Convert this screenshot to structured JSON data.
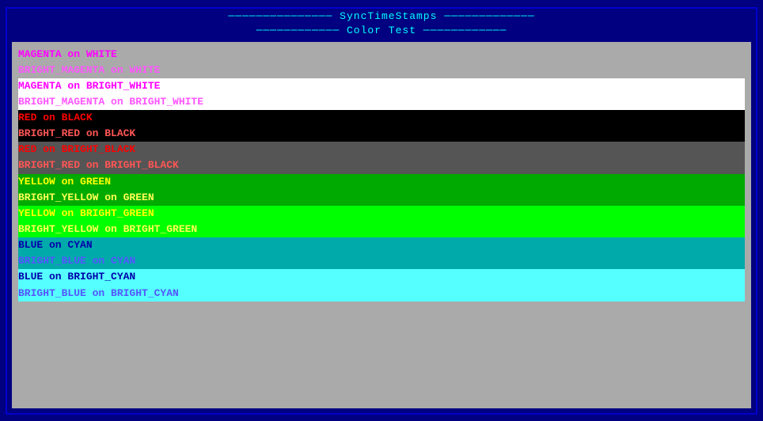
{
  "window": {
    "title": "─────────────── SyncTimeStamps ─────────────",
    "subtitle": "──────────── Color Test ────────────"
  },
  "lines": [
    {
      "id": "magenta-on-white",
      "text": "MAGENTA on WHITE",
      "fg": "#ff00ff",
      "bg": "#aaaaaa"
    },
    {
      "id": "bright-magenta-on-white",
      "text": "BRIGHT_MAGENTA on WHITE",
      "fg": "#ff55ff",
      "bg": "#aaaaaa"
    },
    {
      "id": "magenta-on-bright-white",
      "text": "MAGENTA on BRIGHT_WHITE",
      "fg": "#ff00ff",
      "bg": "#ffffff"
    },
    {
      "id": "bright-magenta-on-bright-white",
      "text": "BRIGHT_MAGENTA on BRIGHT_WHITE",
      "fg": "#ff55ff",
      "bg": "#ffffff"
    },
    {
      "id": "red-on-black",
      "text": "RED on BLACK",
      "fg": "#ff0000",
      "bg": "#000000"
    },
    {
      "id": "bright-red-on-black",
      "text": "BRIGHT_RED on BLACK",
      "fg": "#ff5555",
      "bg": "#000000"
    },
    {
      "id": "red-on-bright-black",
      "text": "RED on BRIGHT_BLACK",
      "fg": "#ff0000",
      "bg": "#555555"
    },
    {
      "id": "bright-red-on-bright-black",
      "text": "BRIGHT_RED on BRIGHT_BLACK",
      "fg": "#ff5555",
      "bg": "#555555"
    },
    {
      "id": "yellow-on-green",
      "text": "YELLOW on GREEN",
      "fg": "#ffff00",
      "bg": "#00aa00"
    },
    {
      "id": "bright-yellow-on-green",
      "text": "BRIGHT_YELLOW on GREEN",
      "fg": "#ffff55",
      "bg": "#00aa00"
    },
    {
      "id": "yellow-on-bright-green",
      "text": "YELLOW on BRIGHT_GREEN",
      "fg": "#ffff00",
      "bg": "#00ff00"
    },
    {
      "id": "bright-yellow-on-bright-green",
      "text": "BRIGHT_YELLOW on BRIGHT_GREEN",
      "fg": "#ffff55",
      "bg": "#00ff00"
    },
    {
      "id": "blue-on-cyan",
      "text": "BLUE on CYAN",
      "fg": "#0000aa",
      "bg": "#00aaaa"
    },
    {
      "id": "bright-blue-on-cyan",
      "text": "BRIGHT_BLUE on CYAN",
      "fg": "#5555ff",
      "bg": "#00aaaa"
    },
    {
      "id": "blue-on-bright-cyan",
      "text": "BLUE on BRIGHT_CYAN",
      "fg": "#0000aa",
      "bg": "#55ffff"
    },
    {
      "id": "bright-blue-on-bright-cyan",
      "text": "BRIGHT_BLUE on BRIGHT_CYAN",
      "fg": "#5555ff",
      "bg": "#55ffff"
    }
  ]
}
